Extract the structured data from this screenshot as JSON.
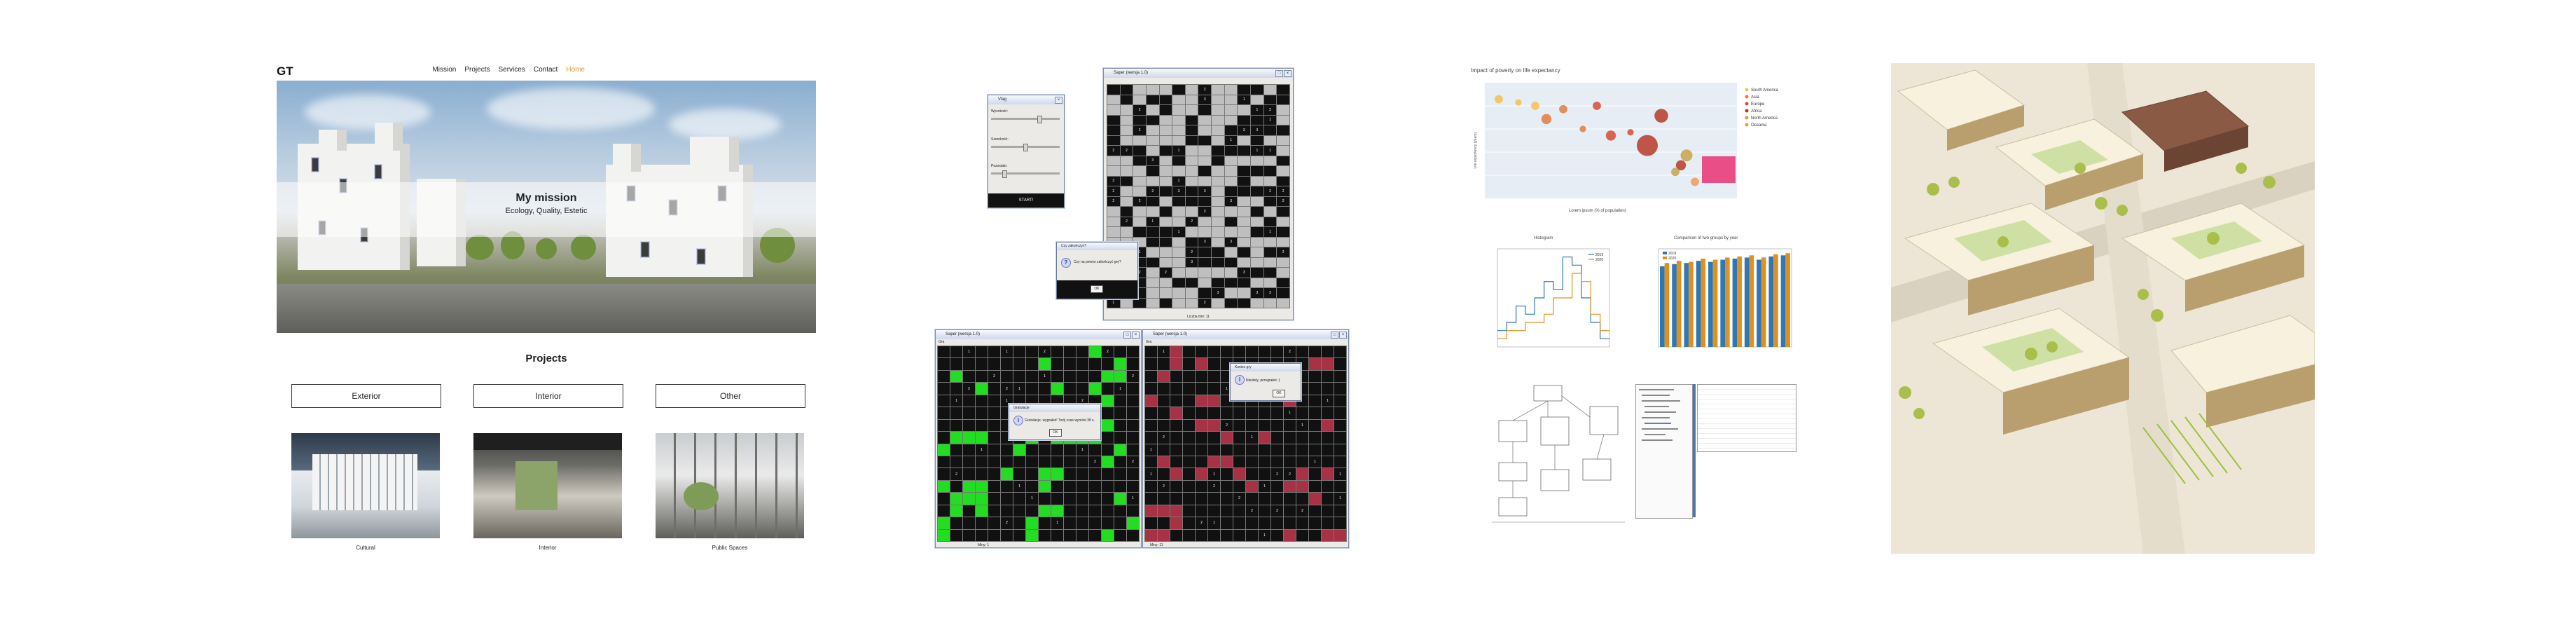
{
  "site": {
    "brand": "GT",
    "nav": [
      "Mission",
      "Projects",
      "Services",
      "Contact",
      "Home"
    ],
    "active_nav": "Home",
    "accent_color": "#e39a2d",
    "hero": {
      "title": "My mission",
      "subtitle": "Ecology, Quality, Estetic"
    },
    "projects_heading": "Projects",
    "categories": [
      "Exterior",
      "Interior",
      "Other"
    ],
    "thumbnails": [
      "Cultural",
      "Interior",
      "Public Spaces"
    ]
  },
  "java_app": {
    "control_window": {
      "title": "Vlag",
      "labels": [
        "Wysokość:",
        "Szerokość:",
        "Pozostało:"
      ],
      "button": "START!"
    },
    "board_window_top": {
      "title": "Saper (wersja 1.0)",
      "status": "Liczba min: 11"
    },
    "question_dialog": {
      "title": "Czy zakończyć?",
      "message": "Czy na pewno zakończyć grę?",
      "ok": "OK"
    },
    "board_window_left": {
      "title": "Saper (wersja 1.0)",
      "menu": "Gra",
      "status": "Miny: 1"
    },
    "board_window_right": {
      "title": "Saper (wersja 1.0)",
      "menu": "Gra",
      "status": "Miny: 11"
    },
    "win_dialog": {
      "title": "Gratulacje",
      "message": "Gratulacje, wygrałeś! Twój czas wyniósł 38 s.",
      "ok": "OK"
    },
    "lose_dialog": {
      "title": "Koniec gry",
      "message": "Niestety, przegrałeś :(",
      "ok": "OK"
    },
    "colors": {
      "cell_dark": "#111111",
      "cell_light": "#bfbfbf",
      "cell_green": "#22dd22",
      "cell_red": "#a83245"
    }
  },
  "charts": {
    "bubble_title": "Impact of poverty on life expectancy",
    "bubble_x_label": "Lorem ipsum (% of population)",
    "bubble_y_label": "Life expectancy (years)",
    "bubble_legend": [
      "South America",
      "Asia",
      "Europe",
      "Africa",
      "North America",
      "Oceania"
    ],
    "bubble_legend_colors": [
      "#f2c14e",
      "#e37b3c",
      "#d94a2f",
      "#b53a2a",
      "#c7a24a",
      "#ec9a5a"
    ],
    "bubble_highlight_color": "#e94f86",
    "hist_title": "Histogram",
    "bar_title": "Comparison of two groups by year",
    "bar_colors": [
      "#2f78b5",
      "#e0901f"
    ],
    "bar_series_names": [
      "2019",
      "2020"
    ]
  },
  "chart_data": [
    {
      "type": "scatter",
      "title": "Impact of poverty on life expectancy",
      "xlabel": "Lorem ipsum (% of population)",
      "ylabel": "Life expectancy (years)",
      "series": [
        {
          "name": "South America",
          "points": [
            [
              5,
              80
            ],
            [
              12,
              79
            ],
            [
              18,
              78
            ]
          ],
          "sizes": [
            3,
            2,
            3
          ]
        },
        {
          "name": "Asia",
          "points": [
            [
              22,
              74
            ],
            [
              28,
              77
            ],
            [
              35,
              71
            ]
          ],
          "sizes": [
            4,
            3,
            2
          ]
        },
        {
          "name": "Europe",
          "points": [
            [
              40,
              78
            ],
            [
              45,
              69
            ],
            [
              52,
              70
            ]
          ],
          "sizes": [
            3,
            4,
            2
          ]
        },
        {
          "name": "Africa",
          "points": [
            [
              58,
              66
            ],
            [
              63,
              75
            ],
            [
              70,
              60
            ]
          ],
          "sizes": [
            10,
            6,
            4
          ]
        },
        {
          "name": "North America",
          "points": [
            [
              68,
              58
            ],
            [
              72,
              63
            ]
          ],
          "sizes": [
            3,
            5
          ]
        },
        {
          "name": "Oceania",
          "points": [
            [
              75,
              55
            ]
          ],
          "sizes": [
            3
          ]
        }
      ],
      "xlim": [
        0,
        90
      ],
      "ylim": [
        50,
        85
      ],
      "legend": "right"
    },
    {
      "type": "line",
      "title": "Histogram",
      "x": [
        0,
        1,
        2,
        3,
        4,
        5,
        6,
        7,
        8,
        9,
        10,
        11
      ],
      "series": [
        {
          "name": "2019",
          "values": [
            2,
            3,
            5,
            4,
            6,
            8,
            7,
            11,
            10,
            6,
            3,
            1
          ]
        },
        {
          "name": "2020",
          "values": [
            1,
            2,
            2,
            3,
            3,
            4,
            6,
            6,
            9,
            8,
            4,
            2
          ]
        }
      ],
      "ylim": [
        0,
        12
      ],
      "legend": "top-right"
    },
    {
      "type": "bar",
      "title": "Comparison of two groups by year",
      "categories": [
        "1",
        "2",
        "3",
        "4",
        "5",
        "6",
        "7",
        "8",
        "9",
        "10",
        "11"
      ],
      "series": [
        {
          "name": "2019",
          "values": [
            74,
            76,
            77,
            79,
            78,
            80,
            81,
            82,
            80,
            83,
            84
          ]
        },
        {
          "name": "2020",
          "values": [
            77,
            79,
            78,
            81,
            80,
            82,
            83,
            84,
            82,
            85,
            86
          ]
        }
      ],
      "ylim": [
        0,
        90
      ],
      "legend": "top-left"
    }
  ]
}
